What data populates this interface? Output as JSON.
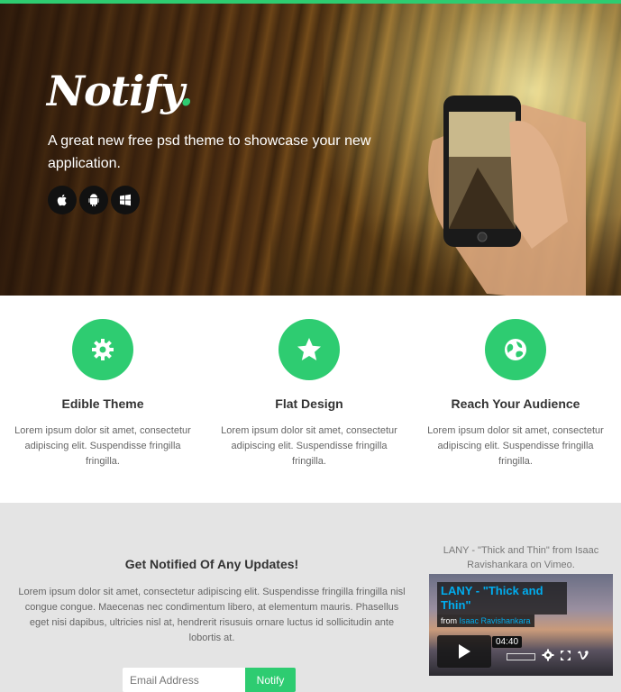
{
  "hero": {
    "logo_text": "Notify",
    "logo_dot": ".",
    "tagline": "A great new free psd theme to showcase your new application.",
    "platforms": [
      {
        "icon": "apple-icon",
        "glyph": ""
      },
      {
        "icon": "android-icon",
        "glyph": ""
      },
      {
        "icon": "windows-icon",
        "glyph": ""
      }
    ]
  },
  "features": [
    {
      "icon": "gear-icon",
      "title": "Edible Theme",
      "text": "Lorem ipsum dolor sit amet, consectetur adipiscing elit. Suspendisse fringilla fringilla."
    },
    {
      "icon": "star-icon",
      "title": "Flat Design",
      "text": "Lorem ipsum dolor sit amet, consectetur adipiscing elit. Suspendisse fringilla fringilla."
    },
    {
      "icon": "globe-icon",
      "title": "Reach Your Audience",
      "text": "Lorem ipsum dolor sit amet, consectetur adipiscing elit. Suspendisse fringilla fringilla."
    }
  ],
  "signup": {
    "title": "Get Notified Of Any Updates!",
    "text": "Lorem ipsum dolor sit amet, consectetur adipiscing elit. Suspendisse fringilla fringilla nisl congue congue. Maecenas nec condimentum libero, at elementum mauris. Phasellus eget nisi dapibus, ultricies nisl at, hendrerit risusuis ornare luctus id sollicitudin ante lobortis at.",
    "email_placeholder": "Email Address",
    "button_label": "Notify"
  },
  "video": {
    "caption": "LANY - \"Thick and Thin\" from Isaac Ravishankara on Vimeo.",
    "title": "LANY - \"Thick and Thin\"",
    "from_label": "from",
    "author": "Isaac Ravishankara",
    "duration": "04:40"
  },
  "colors": {
    "accent": "#2ecc71",
    "vimeo_blue": "#00adef"
  }
}
